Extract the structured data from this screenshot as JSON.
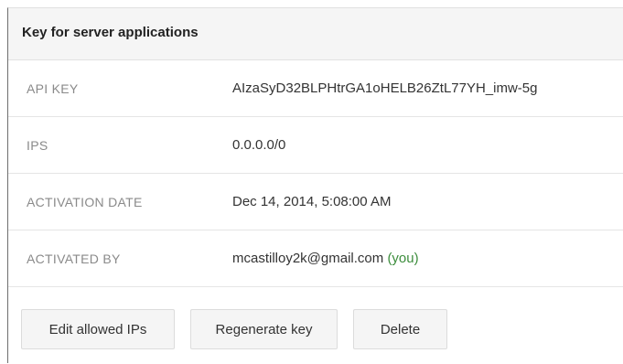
{
  "panel": {
    "title": "Key for server applications",
    "rows": [
      {
        "label": "API KEY",
        "value": "AIzaSyD32BLPHtrGA1oHELB26ZtL77YH_imw-5g"
      },
      {
        "label": "IPS",
        "value": "0.0.0.0/0"
      },
      {
        "label": "ACTIVATION DATE",
        "value": "Dec 14, 2014, 5:08:00 AM"
      },
      {
        "label": "ACTIVATED BY",
        "value": "mcastilloy2k@gmail.com",
        "suffix": "(you)"
      }
    ]
  },
  "actions": {
    "edit_label": "Edit allowed IPs",
    "regenerate_label": "Regenerate key",
    "delete_label": "Delete"
  },
  "colors": {
    "you_accent": "#3c8d3c",
    "header_bg": "#f5f5f5"
  }
}
